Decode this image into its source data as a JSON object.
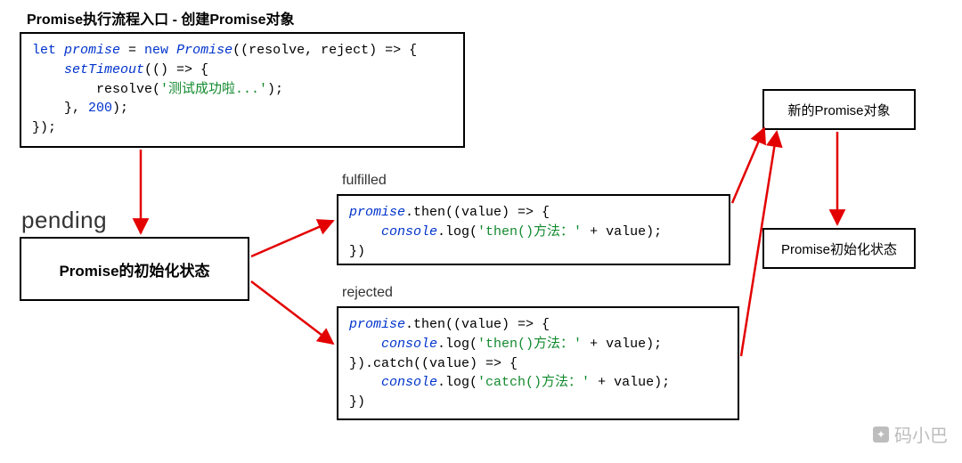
{
  "title": "Promise执行流程入口 - 创建Promise对象",
  "pending_label": "pending",
  "fulfilled_label": "fulfilled",
  "rejected_label": "rejected",
  "state_box_text": "Promise的初始化状态",
  "new_promise_box": "新的Promise对象",
  "init_state_box": "Promise初始化状态",
  "watermark": "码小巴",
  "code_top": {
    "l1_a": "let ",
    "l1_b": "promise",
    "l1_c": " = ",
    "l1_d": "new ",
    "l1_e": "Promise",
    "l1_f": "((resolve, reject) => {",
    "l2_a": "    ",
    "l2_b": "setTimeout",
    "l2_c": "(() => {",
    "l3_a": "        resolve(",
    "l3_b": "'测试成功啦...'",
    "l3_c": ");",
    "l4_a": "    }, ",
    "l4_b": "200",
    "l4_c": ");",
    "l5": "});"
  },
  "code_fulfilled": {
    "l1_a": "promise",
    "l1_b": ".then((value) => {",
    "l2_a": "    ",
    "l2_b": "console",
    "l2_c": ".log(",
    "l2_d": "'then()方法：'",
    "l2_e": " + value);",
    "l3": "})"
  },
  "code_rejected": {
    "l1_a": "promise",
    "l1_b": ".then((value) => {",
    "l2_a": "    ",
    "l2_b": "console",
    "l2_c": ".log(",
    "l2_d": "'then()方法：'",
    "l2_e": " + value);",
    "l3": "}).catch((value) => {",
    "l4_a": "    ",
    "l4_b": "console",
    "l4_c": ".log(",
    "l4_d": "'catch()方法：'",
    "l4_e": " + value);",
    "l5": "})"
  }
}
